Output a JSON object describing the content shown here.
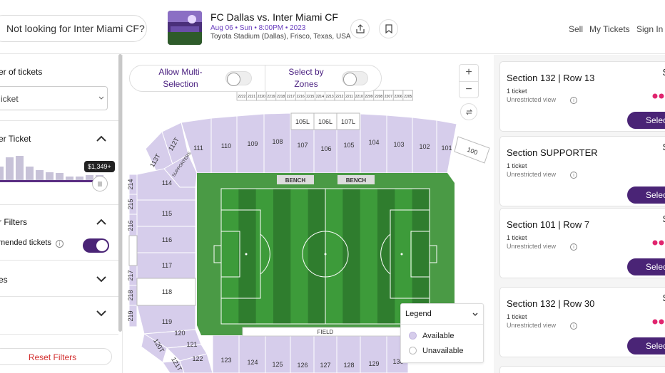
{
  "header": {
    "search_placeholder": "Not looking for Inter Miami CF?",
    "event_title": "FC Dallas vs. Inter Miami CF",
    "event_date": "Aug 06 • Sun • 8:00PM • 2023",
    "event_venue": "Toyota Stadium (Dallas), Frisco, Texas, USA",
    "nav": [
      "Sell",
      "My Tickets",
      "Sign In"
    ]
  },
  "filters": {
    "quantity_label": "er of tickets",
    "quantity_value": "icket",
    "price_label": "er Ticket",
    "price_tooltip": "$1,349+",
    "price_histogram": [
      0.55,
      0.95,
      1.0,
      0.55,
      0.42,
      0.32,
      0.3,
      0.16,
      0.14,
      0.2,
      0.22
    ],
    "other_filters_label": "r Filters",
    "recommended_label": "mended tickets",
    "recommended_on": true,
    "section3_label": "es",
    "reset_label": "Reset Filters"
  },
  "map": {
    "multi_selection_label": "Allow Multi-Selection",
    "zones_label": "Select by Zones",
    "zoom_in": "+",
    "zoom_out": "−",
    "row_numbers": [
      "2222",
      "2221",
      "2220",
      "2219",
      "2218",
      "2217",
      "2216",
      "2215",
      "2214",
      "2213",
      "2212",
      "2211",
      "2210",
      "2209",
      "2208",
      "2207",
      "2206",
      "2205"
    ],
    "sections_top": [
      "111",
      "110",
      "109",
      "108",
      "107",
      "106",
      "105",
      "104",
      "103",
      "102",
      "101"
    ],
    "sections_top_inner": [
      "105L",
      "106L",
      "107L"
    ],
    "sections_corner": [
      "112T",
      "113T",
      "SUPPORTERS",
      "100"
    ],
    "sections_left": [
      "114",
      "115",
      "116",
      "117",
      "118",
      "119",
      "120",
      "121",
      "122",
      "120T",
      "121T"
    ],
    "sections_left_outer": [
      "214",
      "215",
      "216",
      "217",
      "218",
      "219"
    ],
    "sections_bottom": [
      "123",
      "124",
      "125",
      "126",
      "127",
      "128",
      "129",
      "130"
    ],
    "bench_labels": [
      "BENCH",
      "BENCH"
    ],
    "field_label": "FIELD",
    "colors": {
      "available": "#d6cdeb",
      "unavailable": "#ffffff",
      "pitch_dark": "#2f7d2e",
      "pitch_light": "#3d9b3a",
      "apron": "#4a9a45"
    },
    "legend": {
      "title": "Legend",
      "available": "Available",
      "unavailable": "Unavailable"
    }
  },
  "listings": [
    {
      "title": "Section 132 | Row 13",
      "qty": "1 ticket",
      "view": "Unrestricted view",
      "price": "$",
      "button": "Select"
    },
    {
      "title": "Section SUPPORTER",
      "qty": "1 ticket",
      "view": "Unrestricted view",
      "price": "$",
      "button": "Select"
    },
    {
      "title": "Section 101 | Row 7",
      "qty": "1 ticket",
      "view": "Unrestricted view",
      "price": "$",
      "button": "Select"
    },
    {
      "title": "Section 132 | Row 30",
      "qty": "1 ticket",
      "view": "Unrestricted view",
      "price": "$",
      "button": "Select"
    }
  ]
}
